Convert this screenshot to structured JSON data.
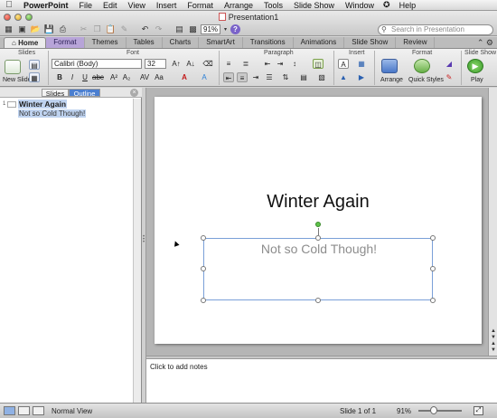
{
  "menubar": {
    "items": [
      "PowerPoint",
      "File",
      "Edit",
      "View",
      "Insert",
      "Format",
      "Arrange",
      "Tools",
      "Slide Show",
      "Window",
      "Help"
    ]
  },
  "window": {
    "title": "Presentation1"
  },
  "toolbar": {
    "zoom": "91%",
    "search_placeholder": "Search in Presentation"
  },
  "ribbon": {
    "tabs": [
      "Home",
      "Format",
      "Themes",
      "Tables",
      "Charts",
      "SmartArt",
      "Transitions",
      "Animations",
      "Slide Show",
      "Review"
    ],
    "groups": [
      "Slides",
      "Font",
      "Paragraph",
      "Insert",
      "Format",
      "Slide Show"
    ],
    "font_name": "Calibri (Body)",
    "font_size": "32",
    "new_slide_label": "New Slide",
    "arrange_label": "Arrange",
    "quick_styles_label": "Quick Styles",
    "play_label": "Play"
  },
  "left_pane": {
    "tabs": [
      "Slides",
      "Outline"
    ],
    "outline": {
      "number": "1",
      "title": "Winter Again",
      "subtitle": "Not so Cold Though!"
    }
  },
  "slide": {
    "title": "Winter Again",
    "subtitle": "Not so Cold Though!"
  },
  "notes": {
    "placeholder": "Click to add notes"
  },
  "status": {
    "view": "Normal View",
    "slide_indicator": "Slide 1 of 1",
    "zoom": "91%"
  },
  "colors": {
    "format_tab": "#b7a4d8",
    "outline_tab_active": "#4b7fd0",
    "selection_box": "#7aa0d8",
    "rotation_handle": "#5fc24a"
  }
}
